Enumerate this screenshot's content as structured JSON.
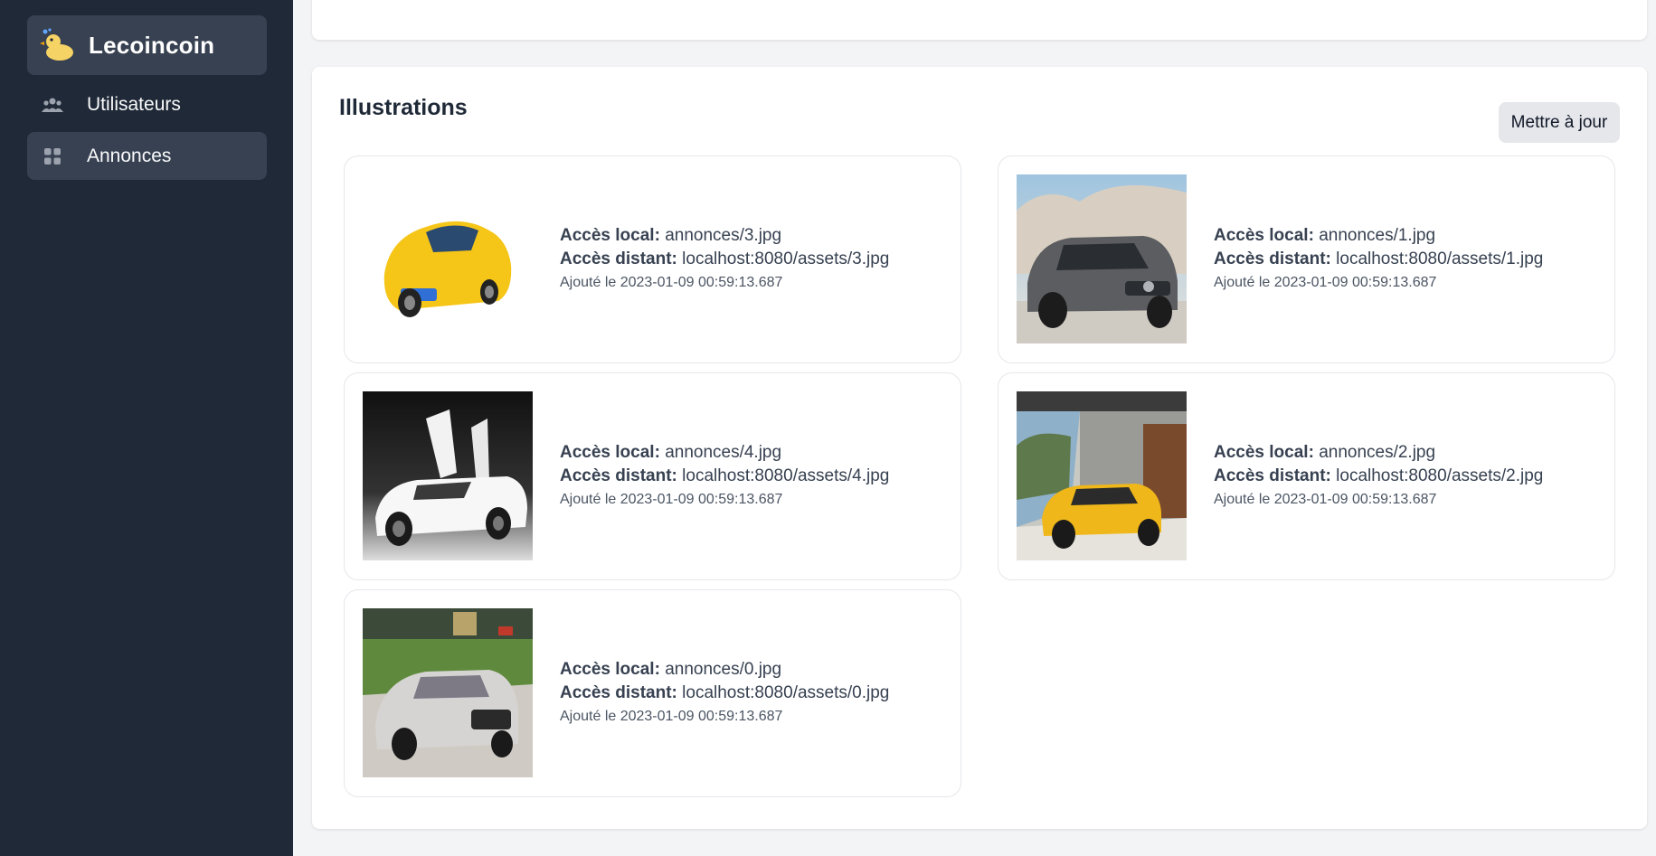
{
  "sidebar": {
    "brand": {
      "name": "Lecoincoin",
      "icon": "duck-logo-icon"
    },
    "items": [
      {
        "label": "Utilisateurs",
        "icon": "users-icon",
        "active": false
      },
      {
        "label": "Annonces",
        "icon": "grid-icon",
        "active": true
      }
    ]
  },
  "illustrations": {
    "title": "Illustrations",
    "update_button": "Mettre à jour",
    "local_label": "Accès local:",
    "remote_label": "Accès distant:",
    "images": [
      {
        "local": "annonces/3.jpg",
        "remote": "localhost:8080/assets/3.jpg",
        "date": "Ajouté le 2023-01-09 00:59:13.687",
        "subject": "yellow sports car"
      },
      {
        "local": "annonces/1.jpg",
        "remote": "localhost:8080/assets/1.jpg",
        "date": "Ajouté le 2023-01-09 00:59:13.687",
        "subject": "grey hatchback"
      },
      {
        "local": "annonces/4.jpg",
        "remote": "localhost:8080/assets/4.jpg",
        "date": "Ajouté le 2023-01-09 00:59:13.687",
        "subject": "white supercar"
      },
      {
        "local": "annonces/2.jpg",
        "remote": "localhost:8080/assets/2.jpg",
        "date": "Ajouté le 2023-01-09 00:59:13.687",
        "subject": "yellow compact car"
      },
      {
        "local": "annonces/0.jpg",
        "remote": "localhost:8080/assets/0.jpg",
        "date": "Ajouté le 2023-01-09 00:59:13.687",
        "subject": "white sedan"
      }
    ]
  },
  "colors": {
    "sidebar_bg": "#1f2937",
    "active_bg": "#374151",
    "page_bg": "#f3f4f6"
  }
}
